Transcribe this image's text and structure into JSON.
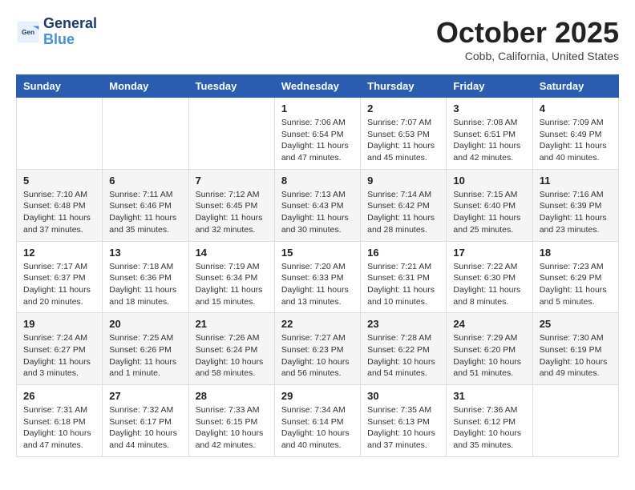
{
  "header": {
    "logo_line1": "General",
    "logo_line2": "Blue",
    "month_title": "October 2025",
    "location": "Cobb, California, United States"
  },
  "days_of_week": [
    "Sunday",
    "Monday",
    "Tuesday",
    "Wednesday",
    "Thursday",
    "Friday",
    "Saturday"
  ],
  "weeks": [
    [
      {
        "day": "",
        "info": ""
      },
      {
        "day": "",
        "info": ""
      },
      {
        "day": "",
        "info": ""
      },
      {
        "day": "1",
        "info": "Sunrise: 7:06 AM\nSunset: 6:54 PM\nDaylight: 11 hours and 47 minutes."
      },
      {
        "day": "2",
        "info": "Sunrise: 7:07 AM\nSunset: 6:53 PM\nDaylight: 11 hours and 45 minutes."
      },
      {
        "day": "3",
        "info": "Sunrise: 7:08 AM\nSunset: 6:51 PM\nDaylight: 11 hours and 42 minutes."
      },
      {
        "day": "4",
        "info": "Sunrise: 7:09 AM\nSunset: 6:49 PM\nDaylight: 11 hours and 40 minutes."
      }
    ],
    [
      {
        "day": "5",
        "info": "Sunrise: 7:10 AM\nSunset: 6:48 PM\nDaylight: 11 hours and 37 minutes."
      },
      {
        "day": "6",
        "info": "Sunrise: 7:11 AM\nSunset: 6:46 PM\nDaylight: 11 hours and 35 minutes."
      },
      {
        "day": "7",
        "info": "Sunrise: 7:12 AM\nSunset: 6:45 PM\nDaylight: 11 hours and 32 minutes."
      },
      {
        "day": "8",
        "info": "Sunrise: 7:13 AM\nSunset: 6:43 PM\nDaylight: 11 hours and 30 minutes."
      },
      {
        "day": "9",
        "info": "Sunrise: 7:14 AM\nSunset: 6:42 PM\nDaylight: 11 hours and 28 minutes."
      },
      {
        "day": "10",
        "info": "Sunrise: 7:15 AM\nSunset: 6:40 PM\nDaylight: 11 hours and 25 minutes."
      },
      {
        "day": "11",
        "info": "Sunrise: 7:16 AM\nSunset: 6:39 PM\nDaylight: 11 hours and 23 minutes."
      }
    ],
    [
      {
        "day": "12",
        "info": "Sunrise: 7:17 AM\nSunset: 6:37 PM\nDaylight: 11 hours and 20 minutes."
      },
      {
        "day": "13",
        "info": "Sunrise: 7:18 AM\nSunset: 6:36 PM\nDaylight: 11 hours and 18 minutes."
      },
      {
        "day": "14",
        "info": "Sunrise: 7:19 AM\nSunset: 6:34 PM\nDaylight: 11 hours and 15 minutes."
      },
      {
        "day": "15",
        "info": "Sunrise: 7:20 AM\nSunset: 6:33 PM\nDaylight: 11 hours and 13 minutes."
      },
      {
        "day": "16",
        "info": "Sunrise: 7:21 AM\nSunset: 6:31 PM\nDaylight: 11 hours and 10 minutes."
      },
      {
        "day": "17",
        "info": "Sunrise: 7:22 AM\nSunset: 6:30 PM\nDaylight: 11 hours and 8 minutes."
      },
      {
        "day": "18",
        "info": "Sunrise: 7:23 AM\nSunset: 6:29 PM\nDaylight: 11 hours and 5 minutes."
      }
    ],
    [
      {
        "day": "19",
        "info": "Sunrise: 7:24 AM\nSunset: 6:27 PM\nDaylight: 11 hours and 3 minutes."
      },
      {
        "day": "20",
        "info": "Sunrise: 7:25 AM\nSunset: 6:26 PM\nDaylight: 11 hours and 1 minute."
      },
      {
        "day": "21",
        "info": "Sunrise: 7:26 AM\nSunset: 6:24 PM\nDaylight: 10 hours and 58 minutes."
      },
      {
        "day": "22",
        "info": "Sunrise: 7:27 AM\nSunset: 6:23 PM\nDaylight: 10 hours and 56 minutes."
      },
      {
        "day": "23",
        "info": "Sunrise: 7:28 AM\nSunset: 6:22 PM\nDaylight: 10 hours and 54 minutes."
      },
      {
        "day": "24",
        "info": "Sunrise: 7:29 AM\nSunset: 6:20 PM\nDaylight: 10 hours and 51 minutes."
      },
      {
        "day": "25",
        "info": "Sunrise: 7:30 AM\nSunset: 6:19 PM\nDaylight: 10 hours and 49 minutes."
      }
    ],
    [
      {
        "day": "26",
        "info": "Sunrise: 7:31 AM\nSunset: 6:18 PM\nDaylight: 10 hours and 47 minutes."
      },
      {
        "day": "27",
        "info": "Sunrise: 7:32 AM\nSunset: 6:17 PM\nDaylight: 10 hours and 44 minutes."
      },
      {
        "day": "28",
        "info": "Sunrise: 7:33 AM\nSunset: 6:15 PM\nDaylight: 10 hours and 42 minutes."
      },
      {
        "day": "29",
        "info": "Sunrise: 7:34 AM\nSunset: 6:14 PM\nDaylight: 10 hours and 40 minutes."
      },
      {
        "day": "30",
        "info": "Sunrise: 7:35 AM\nSunset: 6:13 PM\nDaylight: 10 hours and 37 minutes."
      },
      {
        "day": "31",
        "info": "Sunrise: 7:36 AM\nSunset: 6:12 PM\nDaylight: 10 hours and 35 minutes."
      },
      {
        "day": "",
        "info": ""
      }
    ]
  ]
}
